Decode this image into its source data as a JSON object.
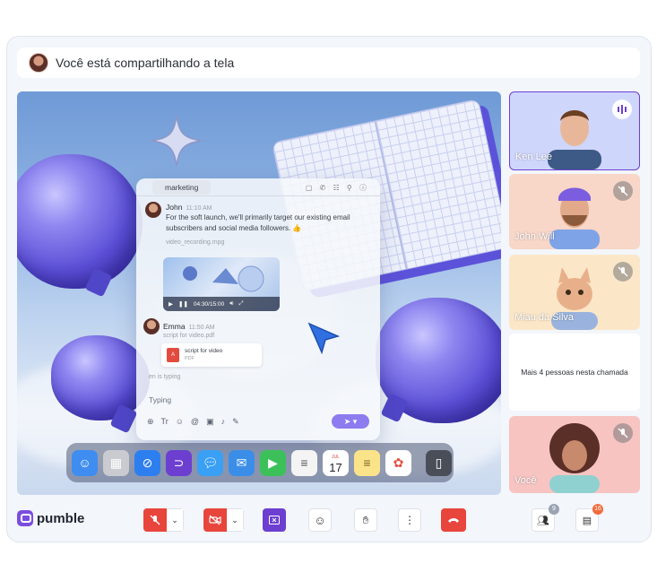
{
  "header": {
    "share_text": "Você está compartilhando a tela"
  },
  "shared_screen": {
    "channel_tab": "marketing",
    "messages": [
      {
        "author": "John",
        "time": "11:10 AM",
        "text": "For the soft launch, we'll primarily target our existing email subscribers and social media followers. 👍",
        "attachment_label": "video_recording.mpg"
      },
      {
        "author": "Emma",
        "time": "11:50 AM",
        "attachment_label": "script for video.pdf"
      }
    ],
    "video_time": "04:30/15:00",
    "file": {
      "name": "script for video",
      "type": "PDF"
    },
    "typing_indicator": "en is typing",
    "composer_placeholder": "Typing",
    "dock_calendar": {
      "month": "JUL",
      "day": "17"
    }
  },
  "participants": [
    {
      "name": "Ken Lee",
      "status": "speaking",
      "bg": "#cfd6fb"
    },
    {
      "name": "John Will",
      "status": "muted",
      "bg": "#f8d6c8"
    },
    {
      "name": "Miau da Silva",
      "status": "muted",
      "bg": "#fbe7c8"
    },
    {
      "more_text": "Mais 4 pessoas nesta chamada"
    },
    {
      "name": "Você",
      "status": "muted",
      "bg": "#f7c4c2"
    }
  ],
  "toolbar": {
    "brand": "pumble",
    "participants_count": "9",
    "chat_count": "16"
  },
  "colors": {
    "accent": "#6c3fd0",
    "danger": "#e8453c",
    "brand": "#7b4ce0"
  },
  "icons": [
    "mic-off-icon",
    "video-off-icon",
    "stop-share-icon",
    "emoji-icon",
    "raise-hand-icon",
    "more-icon",
    "hang-up-icon",
    "participants-icon",
    "chat-icon"
  ]
}
